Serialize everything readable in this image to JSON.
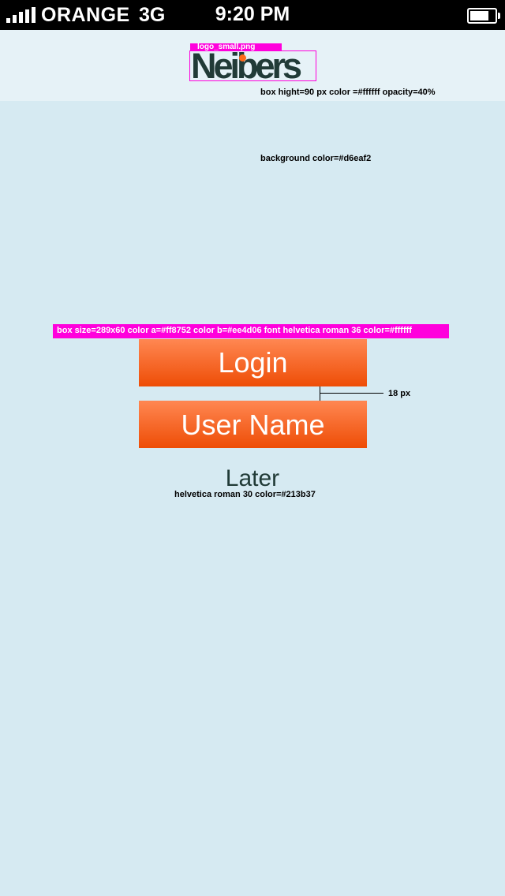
{
  "status_bar": {
    "carrier": "ORANGE",
    "network": "3G",
    "time": "9:20 PM",
    "battery_level": 0.9
  },
  "header": {
    "logo_file_label": "logo_small.png",
    "logo_text": "Neibers"
  },
  "annotations": {
    "header_box": "box hight=90 px color =#ffffff opacity=40%",
    "background": "background color=#d6eaf2",
    "button_spec": "box size=289x60 color a=#ff8752 color b=#ee4d06 font helvetica roman 36 color=#ffffff",
    "gap": "18 px",
    "later_spec": "helvetica roman 30 color=#213b37"
  },
  "buttons": {
    "login": "Login",
    "user_name": "User Name",
    "later": "Later"
  },
  "colors": {
    "background": "#d6eaf2",
    "button_top": "#ff8752",
    "button_bottom": "#ee4d06",
    "button_text": "#ffffff",
    "later_text": "#213b37",
    "annotation_highlight": "#ff00dc"
  }
}
